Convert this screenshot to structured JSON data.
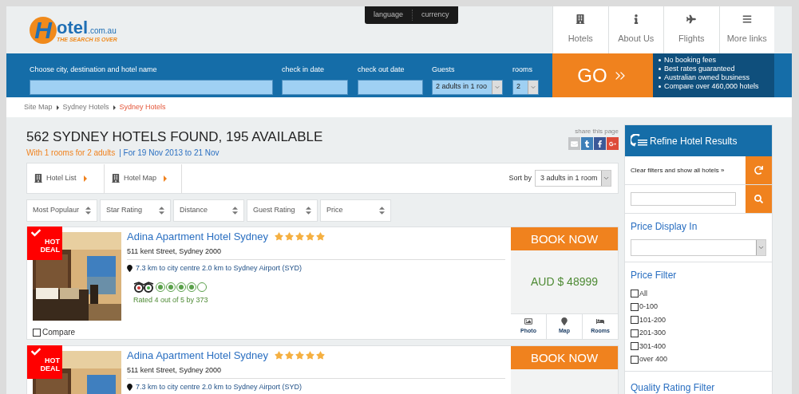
{
  "header": {
    "logo": {
      "letter": "H",
      "name": "otel",
      "domain": ".com.au",
      "tagline": "THE SEARCH IS OVER"
    },
    "top_tabs": [
      "language",
      "currency"
    ],
    "nav": [
      {
        "label": "Hotels",
        "kind": "building"
      },
      {
        "label": "About Us",
        "kind": "info"
      },
      {
        "label": "Flights",
        "kind": "plane"
      },
      {
        "label": "More links",
        "kind": "menu"
      }
    ]
  },
  "search": {
    "destination": {
      "label": "Choose city, destination and hotel name"
    },
    "check_in": {
      "label": "check in date"
    },
    "check_out": {
      "label": "check out date"
    },
    "guests": {
      "label": "Guests",
      "value": "2 adults in 1 roo"
    },
    "rooms": {
      "label": "rooms",
      "value": "2"
    },
    "go": "GO",
    "benefits": [
      "No booking fees",
      "Best rates guaranteed",
      "Australian owned business",
      "Compare over 460,000 hotels"
    ]
  },
  "breadcrumb": [
    {
      "label": "Site Map",
      "selected": false
    },
    {
      "label": "Sydney Hotels",
      "selected": false
    },
    {
      "label": "Sydney Hotels",
      "selected": true
    }
  ],
  "results": {
    "title": "562 SYDNEY HOTELS FOUND, 195 AVAILABLE",
    "occupancy": "With 1 rooms for 2 adults",
    "dates": "| For 19 Nov 2013 to 21 Nov",
    "share_label": "share this page",
    "share": [
      {
        "kind": "mail"
      },
      {
        "kind": "tumblr"
      },
      {
        "kind": "facebook"
      },
      {
        "kind": "google"
      }
    ],
    "views": [
      "Hotel List",
      "Hotel Map"
    ],
    "sort_label": "Sort by",
    "sort_value": "3 adults in 1 room",
    "sort_buttons": [
      "Most Populaur",
      "Star Rating",
      "Distance",
      "Guest Rating",
      "Price"
    ]
  },
  "hotels": [
    {
      "badge": [
        "HOT",
        "DEAL"
      ],
      "name": "Adina Apartment Hotel Sydney",
      "stars": 5,
      "address": "511 kent Street, Sydney 2000",
      "distance": "7.3 km to city centre 2.0 km to Sydney Airport (SYD)",
      "rating": {
        "stars": 4,
        "text": "Rated 4 out of 5 by 373"
      },
      "compare": {
        "label": "Compare",
        "checked": false
      },
      "book": "BOOK NOW",
      "price": "AUD $ 48999",
      "actions": [
        {
          "label": "Photo"
        },
        {
          "label": "Map",
          "kind": "map"
        },
        {
          "label": "Rooms",
          "kind": "rooms"
        }
      ]
    },
    {
      "badge": [
        "HOT",
        "DEAL"
      ],
      "name": "Adina Apartment Hotel Sydney",
      "stars": 5,
      "address": "511 kent Street, Sydney 2000",
      "distance": "7.3 km to city centre 2.0 km to Sydney Airport (SYD)",
      "book": "BOOK NOW"
    }
  ],
  "sidebar": {
    "title": "Refine Hotel Results",
    "clear": "Clear filters and show all hotels »",
    "price_display": {
      "title": "Price Display In"
    },
    "price_filter": {
      "title": "Price Filter",
      "options": [
        {
          "label": "All",
          "checked": false
        },
        {
          "label": "0-100",
          "checked": false
        },
        {
          "label": "101-200",
          "checked": false
        },
        {
          "label": "201-300",
          "checked": false
        },
        {
          "label": "301-400",
          "checked": false
        },
        {
          "label": "over 400",
          "checked": false
        }
      ]
    },
    "quality_filter": {
      "title": "Quality Rating Filter"
    }
  }
}
